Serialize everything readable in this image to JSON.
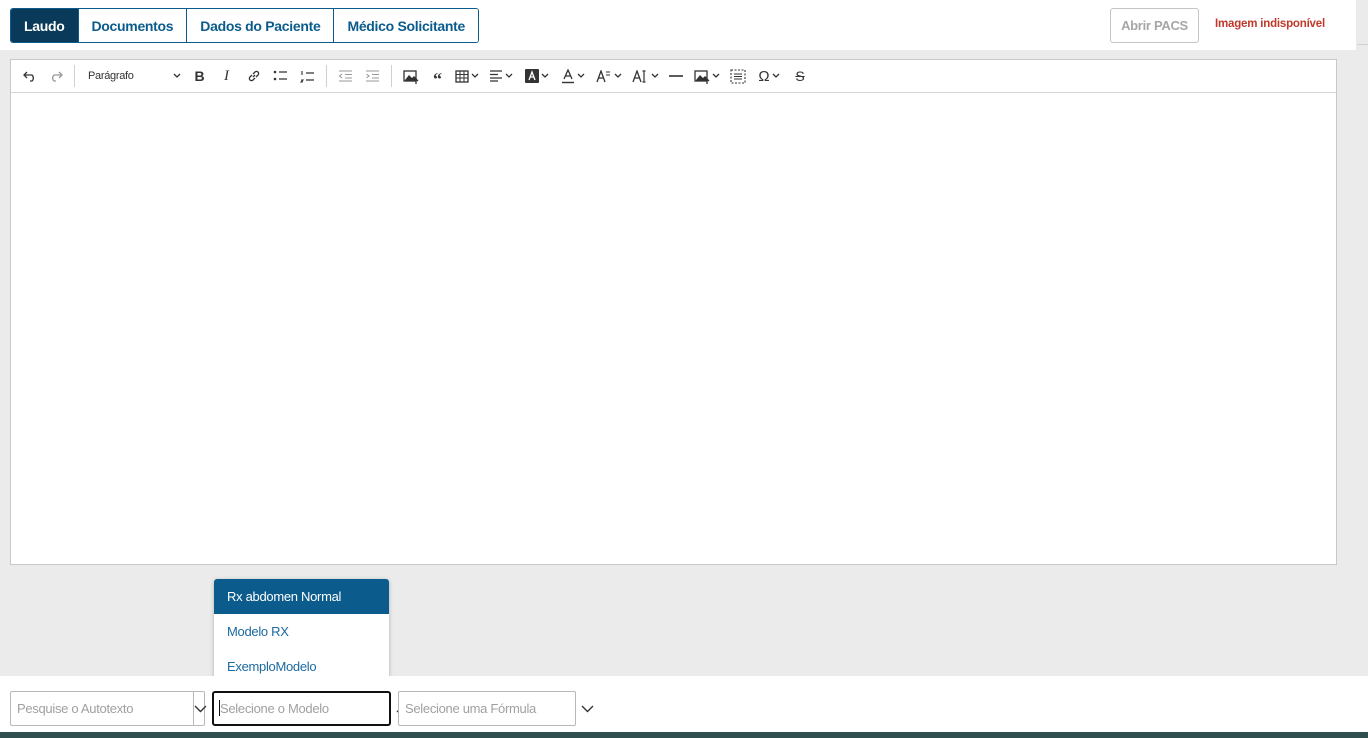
{
  "tabs": [
    {
      "label": "Laudo",
      "active": true
    },
    {
      "label": "Documentos",
      "active": false
    },
    {
      "label": "Dados do Paciente",
      "active": false
    },
    {
      "label": "Médico Solicitante",
      "active": false
    }
  ],
  "header": {
    "pacs_button": "Abrir PACS",
    "image_status": "Imagem indisponível"
  },
  "toolbar": {
    "paragraph_select": "Parágrafo",
    "icons": [
      "undo-icon",
      "redo-icon",
      "bold-icon",
      "italic-icon",
      "link-icon",
      "bulleted-list-icon",
      "numbered-list-icon",
      "outdent-icon",
      "indent-icon",
      "insert-image-icon",
      "block-quote-icon",
      "table-icon",
      "alignment-icon",
      "highlight-icon",
      "font-color-icon",
      "font-size-icon",
      "font-family-icon",
      "horizontal-line-icon",
      "image-upload-icon",
      "select-all-icon",
      "special-characters-icon",
      "strikethrough-icon"
    ]
  },
  "model_dropdown": {
    "options": [
      "Rx abdomen Normal",
      "Modelo RX",
      "ExemploModelo"
    ],
    "highlighted_index": 0
  },
  "bottom": {
    "autotexto_placeholder": "Pesquise o Autotexto",
    "modelo_placeholder": "Selecione o Modelo",
    "formula_placeholder": "Selecione uma Fórmula"
  },
  "colors": {
    "primary": "#0b5c8c",
    "active_tab": "#0a3a5a",
    "warning_text": "#c0392b"
  }
}
